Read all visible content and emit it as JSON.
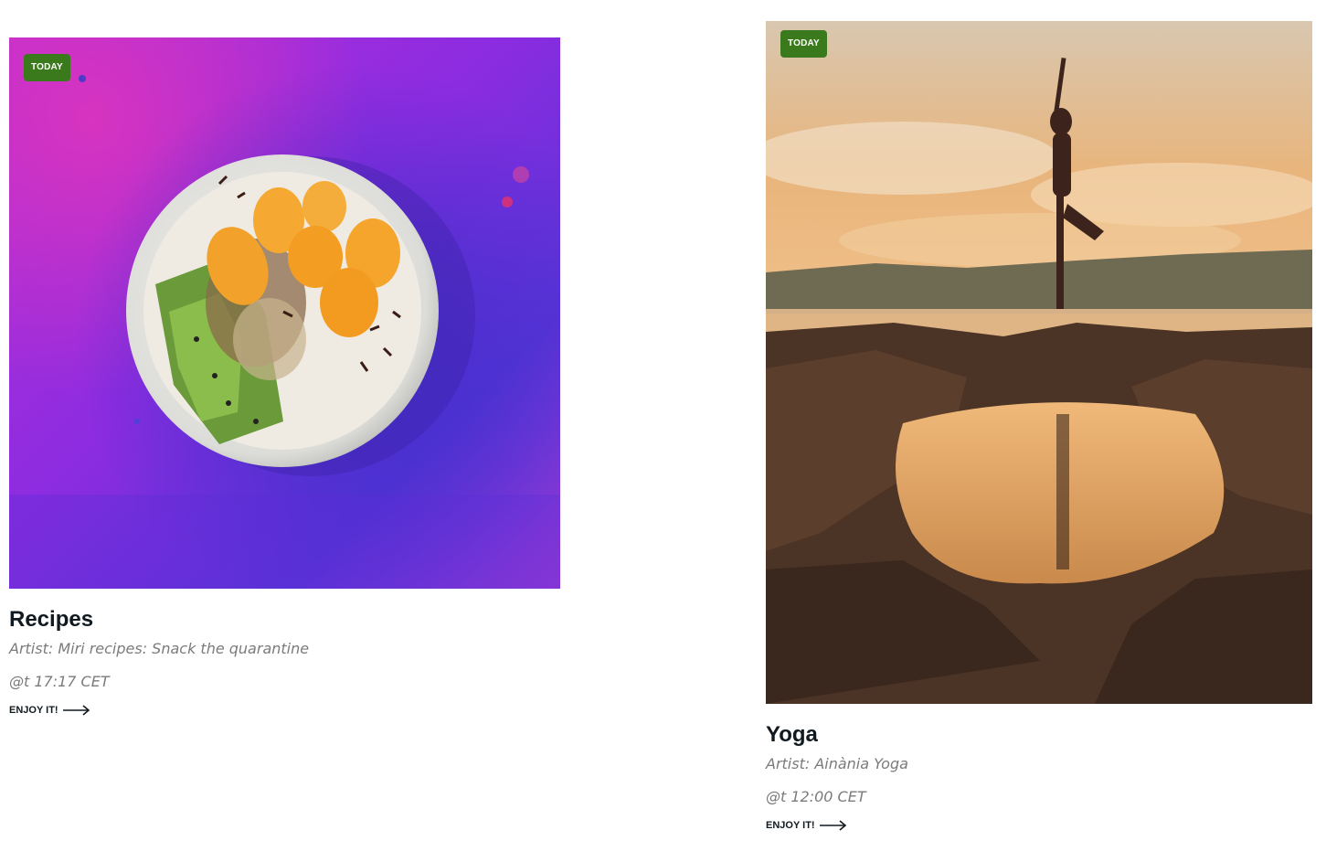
{
  "cards": [
    {
      "badge": "TODAY",
      "title": "Recipes",
      "artist": "Artist: Miri recipes: Snack the quarantine",
      "time": "@t 17:17 CET",
      "link_label": "ENJOY IT!",
      "image_subject": "fruit bowl with orange slices and kiwi on purple painted surface"
    },
    {
      "badge": "TODAY",
      "title": "Yoga",
      "artist": "Artist: Ainània Yoga",
      "time": "@t 12:00 CET",
      "link_label": "ENJOY IT!",
      "image_subject": "woman in tree pose on rocks at sunset reflected in a tide pool"
    }
  ],
  "colors": {
    "badge_bg": "#3a7a1c",
    "title": "#111a20",
    "meta_text": "#7b7b7b"
  },
  "icons": {
    "link_arrow": "arrow-right-icon"
  }
}
